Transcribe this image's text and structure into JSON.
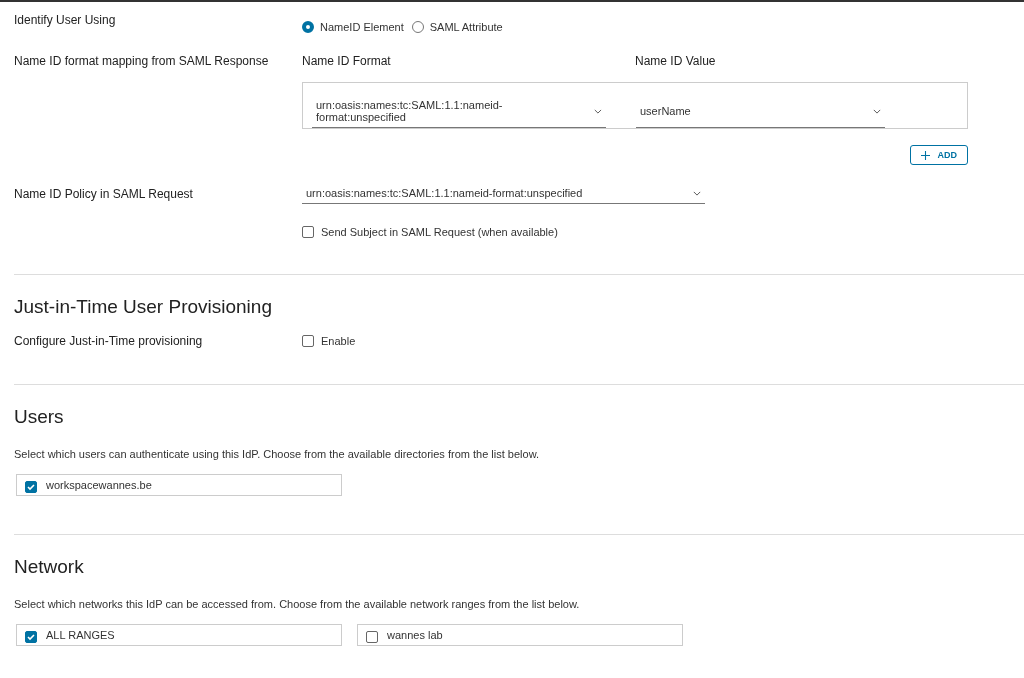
{
  "identify_user": {
    "label": "Identify User Using",
    "options": [
      {
        "label": "NameID Element",
        "selected": true
      },
      {
        "label": "SAML Attribute",
        "selected": false
      }
    ]
  },
  "name_id_mapping": {
    "label": "Name ID format mapping from SAML Response",
    "columns": [
      "Name ID Format",
      "Name ID Value"
    ],
    "rows": [
      {
        "format": "urn:oasis:names:tc:SAML:1.1:nameid-format:unspecified",
        "value": "userName"
      }
    ],
    "add_button": "ADD"
  },
  "name_id_policy": {
    "label": "Name ID Policy in SAML Request",
    "value": "urn:oasis:names:tc:SAML:1.1:nameid-format:unspecified",
    "send_subject": {
      "label": "Send Subject in SAML Request (when available)",
      "checked": false
    }
  },
  "jit": {
    "title": "Just-in-Time User Provisioning",
    "label": "Configure Just-in-Time provisioning",
    "enable": {
      "label": "Enable",
      "checked": false
    }
  },
  "users": {
    "title": "Users",
    "description": "Select which users can authenticate using this IdP. Choose from the available directories from the list below.",
    "directories": [
      {
        "label": "workspacewannes.be",
        "checked": true
      }
    ]
  },
  "network": {
    "title": "Network",
    "description": "Select which networks this IdP can be accessed from. Choose from the available network ranges from the list below.",
    "ranges": [
      {
        "label": "ALL RANGES",
        "checked": true
      },
      {
        "label": "wannes lab",
        "checked": false
      }
    ]
  }
}
